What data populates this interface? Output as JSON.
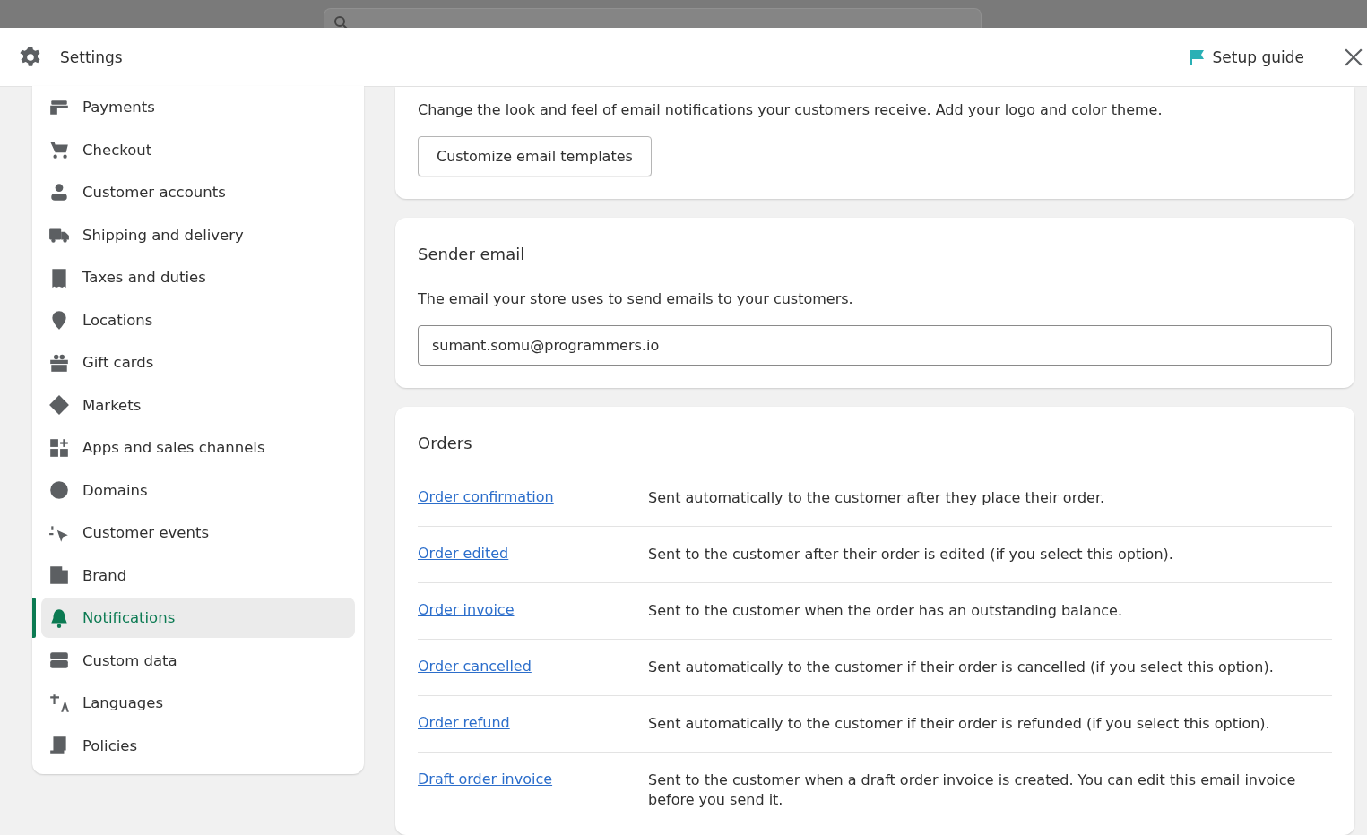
{
  "header": {
    "title": "Settings",
    "setup_guide": "Setup guide"
  },
  "sidebar": {
    "items": [
      {
        "label": "Payments",
        "selected": false
      },
      {
        "label": "Checkout",
        "selected": false
      },
      {
        "label": "Customer accounts",
        "selected": false
      },
      {
        "label": "Shipping and delivery",
        "selected": false
      },
      {
        "label": "Taxes and duties",
        "selected": false
      },
      {
        "label": "Locations",
        "selected": false
      },
      {
        "label": "Gift cards",
        "selected": false
      },
      {
        "label": "Markets",
        "selected": false
      },
      {
        "label": "Apps and sales channels",
        "selected": false
      },
      {
        "label": "Domains",
        "selected": false
      },
      {
        "label": "Customer events",
        "selected": false
      },
      {
        "label": "Brand",
        "selected": false
      },
      {
        "label": "Notifications",
        "selected": true
      },
      {
        "label": "Custom data",
        "selected": false
      },
      {
        "label": "Languages",
        "selected": false
      },
      {
        "label": "Policies",
        "selected": false
      }
    ]
  },
  "customize": {
    "description": "Change the look and feel of email notifications your customers receive. Add your logo and color theme.",
    "button": "Customize email templates"
  },
  "sender_email": {
    "title": "Sender email",
    "description": "The email your store uses to send emails to your customers.",
    "value": "sumant.somu@programmers.io"
  },
  "orders": {
    "title": "Orders",
    "rows": [
      {
        "link": "Order confirmation",
        "description": "Sent automatically to the customer after they place their order."
      },
      {
        "link": "Order edited",
        "description": "Sent to the customer after their order is edited (if you select this option)."
      },
      {
        "link": "Order invoice",
        "description": "Sent to the customer when the order has an outstanding balance."
      },
      {
        "link": "Order cancelled",
        "description": "Sent automatically to the customer if their order is cancelled (if you select this option)."
      },
      {
        "link": "Order refund",
        "description": "Sent automatically to the customer if their order is refunded (if you select this option)."
      },
      {
        "link": "Draft order invoice",
        "description": "Sent to the customer when a draft order invoice is created. You can edit this email invoice before you send it."
      }
    ]
  }
}
